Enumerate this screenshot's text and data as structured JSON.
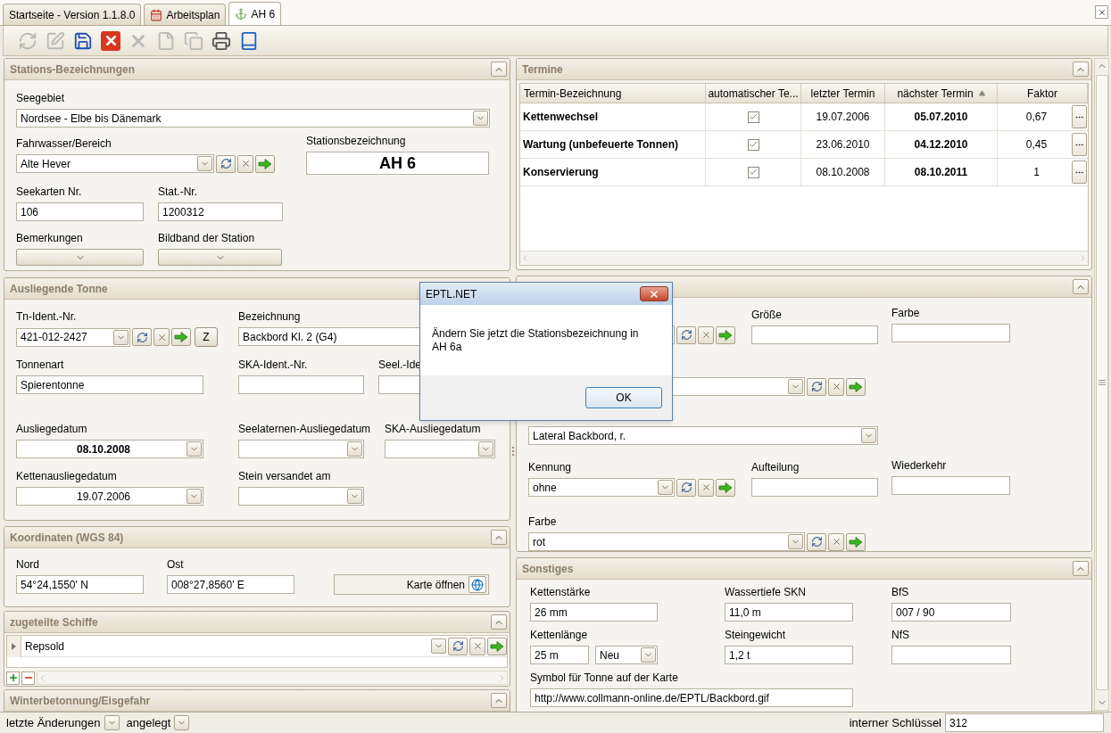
{
  "tabs": [
    {
      "label": "Startseite - Version 1.1.8.0",
      "kind": "none",
      "selected": false
    },
    {
      "label": "Arbeitsplan",
      "kind": "calendar",
      "selected": false
    },
    {
      "label": "AH 6",
      "kind": "buoy",
      "selected": true
    }
  ],
  "toolbar": [
    {
      "kind": "refresh",
      "disabled": true
    },
    {
      "kind": "edit",
      "disabled": true
    },
    {
      "kind": "save",
      "disabled": false
    },
    {
      "kind": "cancel",
      "disabled": false
    },
    {
      "kind": "delete",
      "disabled": true
    },
    {
      "kind": "new",
      "disabled": true
    },
    {
      "kind": "copy",
      "disabled": true
    },
    {
      "kind": "print",
      "disabled": false
    },
    {
      "kind": "help",
      "disabled": false
    }
  ],
  "stations": {
    "title": "Stations-Bezeichnungen",
    "seegebiet": {
      "label": "Seegebiet",
      "value": "Nordsee - Elbe bis Dänemark"
    },
    "fahrwasser": {
      "label": "Fahrwasser/Bereich",
      "value": "Alte Hever"
    },
    "stationsbezeichnung": {
      "label": "Stationsbezeichnung",
      "value": "AH 6"
    },
    "seekarten": {
      "label": "Seekarten Nr.",
      "value": "106"
    },
    "stat_nr": {
      "label": "Stat.-Nr.",
      "value": "1200312"
    },
    "bemerkungen": {
      "label": "Bemerkungen"
    },
    "bildband": {
      "label": "Bildband der Station"
    }
  },
  "tonne": {
    "title": "Ausliegende Tonne",
    "tn_ident": {
      "label": "Tn-Ident.-Nr.",
      "value": "421-012-2427"
    },
    "z_button": "Z",
    "bezeichnung": {
      "label": "Bezeichnung",
      "value": "Backbord Kl. 2 (G4)"
    },
    "tonnenart": {
      "label": "Tonnenart",
      "value": "Spierentonne"
    },
    "ska_ident": {
      "label": "SKA-Ident.-Nr."
    },
    "seel_ident": {
      "label": "Seel.-Ide"
    },
    "ausliegedatum": {
      "label": "Ausliegedatum",
      "value": "08.10.2008"
    },
    "seelaternen": {
      "label": "Seelaternen-Ausliegedatum"
    },
    "ska_ausliegedatum": {
      "label": "SKA-Ausliegedatum"
    },
    "kettenausliegedatum": {
      "label": "Kettenausliegedatum",
      "value": "19.07.2006"
    },
    "stein": {
      "label": "Stein versandet am"
    }
  },
  "koordinaten": {
    "title": "Koordinaten (WGS 84)",
    "nord": {
      "label": "Nord",
      "value": "54°24,1550' N"
    },
    "ost": {
      "label": "Ost",
      "value": "008°27,8560' E"
    },
    "map_button": "Karte öffnen"
  },
  "schiffe": {
    "title": "zugeteilte Schiffe",
    "rows": [
      {
        "value": "Repsold"
      }
    ]
  },
  "winter": {
    "title": "Winterbetonnung/Eisgefahr"
  },
  "termine": {
    "title": "Termine",
    "columns": [
      {
        "label": "Termin-Bezeichnung",
        "sorted": false
      },
      {
        "label": "automatischer Te...",
        "sorted": false
      },
      {
        "label": "letzter Termin",
        "sorted": false
      },
      {
        "label": "nächster Termin",
        "sorted": true
      },
      {
        "label": "Faktor",
        "sorted": false
      }
    ],
    "rows": [
      {
        "name": "Kettenwechsel",
        "automatic": true,
        "last": "19.07.2006",
        "next": "05.07.2010",
        "factor": "0,67"
      },
      {
        "name": "Wartung (unbefeuerte Tonnen)",
        "automatic": true,
        "last": "23.06.2010",
        "next": "04.12.2010",
        "factor": "0,45"
      },
      {
        "name": "Konservierung",
        "automatic": true,
        "last": "08.10.2008",
        "next": "08.10.2011",
        "factor": "1"
      }
    ]
  },
  "details": {
    "groesse": {
      "label": "Größe"
    },
    "farbe_oben": {
      "label": "Farbe"
    },
    "form": {
      "value": "Lateral Backbord, r."
    },
    "kennung": {
      "label": "Kennung",
      "value": "ohne"
    },
    "aufteilung": {
      "label": "Aufteilung"
    },
    "wiederkehr": {
      "label": "Wiederkehr"
    },
    "farbe": {
      "label": "Farbe",
      "value": "rot"
    }
  },
  "sonstiges": {
    "title": "Sonstiges",
    "kettenstaerke": {
      "label": "Kettenstärke",
      "value": "26 mm"
    },
    "wassertiefe": {
      "label": "Wassertiefe SKN",
      "value": "11,0 m"
    },
    "bfs": {
      "label": "BfS",
      "value": "007 / 90"
    },
    "kettenlaenge": {
      "label": "Kettenlänge",
      "value": "25 m",
      "state": "Neu"
    },
    "steingewicht": {
      "label": "Steingewicht",
      "value": "1,2 t"
    },
    "nfs": {
      "label": "NfS"
    },
    "symbol": {
      "label": "Symbol für Tonne auf der Karte",
      "value": "http://www.collmann-online.de/EPTL/Backbord.gif"
    }
  },
  "status_bar": {
    "changes": "letzte Änderungen",
    "created": "angelegt",
    "key_label": "interner Schlüssel",
    "key_value": "312"
  },
  "dialog": {
    "title": "EPTL.NET",
    "message": "Ändern Sie jetzt die Stationsbezeichnung in AH 6a",
    "ok": "OK"
  }
}
